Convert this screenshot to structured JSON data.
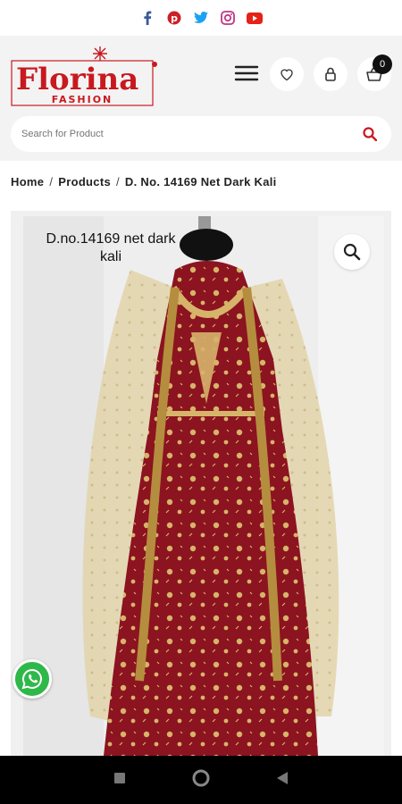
{
  "social": {
    "icons": [
      "facebook-icon",
      "pinterest-icon",
      "twitter-icon",
      "instagram-icon",
      "youtube-icon"
    ],
    "colors": {
      "facebook": "#3b5998",
      "pinterest": "#cb2027",
      "twitter": "#1da1f2",
      "instagram": "#c13584",
      "youtube": "#e62117"
    }
  },
  "header": {
    "brand": "Florina",
    "brand_sub": "FASHION",
    "cart_count": "0"
  },
  "search": {
    "placeholder": "Search for Product"
  },
  "breadcrumb": {
    "home": "Home",
    "sep1": "/",
    "products": "Products",
    "sep2": "/",
    "current": "D. No. 14169 Net Dark Kali"
  },
  "product": {
    "image_caption_line1": "D.no.14169 net dark",
    "image_caption_line2": "kali"
  },
  "theme": {
    "brand_red": "#c8191f",
    "accent": "#d9534f"
  }
}
